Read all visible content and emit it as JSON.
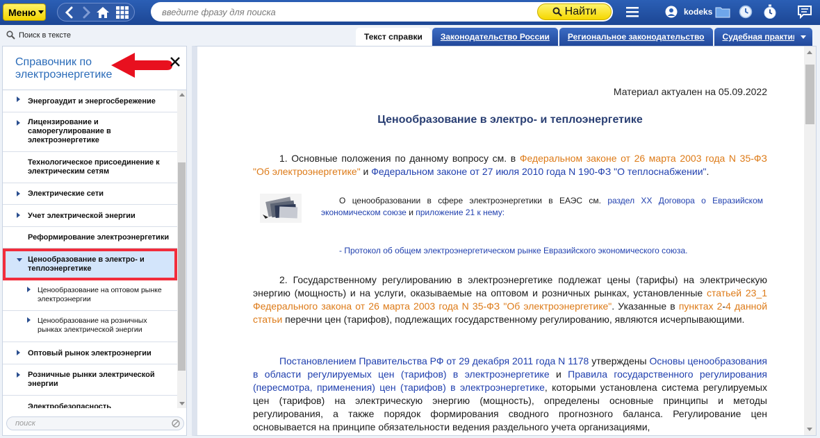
{
  "topbar": {
    "menu_label": "Меню",
    "search_placeholder": "введите фразу для поиска",
    "find_label": "Найти",
    "user_name": "kodeks"
  },
  "row2": {
    "search_in_text": "Поиск в тексте",
    "tabs": [
      {
        "label": "Текст справки",
        "active": true
      },
      {
        "label": "Законодательство России",
        "active": false
      },
      {
        "label": "Региональное законодательство",
        "active": false
      },
      {
        "label": "Судебная практика",
        "active": false
      }
    ]
  },
  "left_panel": {
    "title": "Справочник по электроэнергетике",
    "search_placeholder": "поиск",
    "items": [
      {
        "label": "Энергоаудит и энергосбережение",
        "level": 1
      },
      {
        "label": "Лицензирование и саморегулирование в электроэнергетике",
        "level": 1
      },
      {
        "label": "Технологическое присоединение к электрическим сетям",
        "level": 1
      },
      {
        "label": "Электрические сети",
        "level": 1
      },
      {
        "label": "Учет электрической энергии",
        "level": 1
      },
      {
        "label": "Реформирование электроэнергетики",
        "level": 1
      },
      {
        "label": "Ценообразование в электро- и теплоэнергетике",
        "level": 1,
        "selected": true
      },
      {
        "label": "Ценообразование на оптовом рынке электроэнергии",
        "level": 2
      },
      {
        "label": "Ценообразование на розничных рынках электрической энергии",
        "level": 2
      },
      {
        "label": "Оптовый рынок электроэнергии",
        "level": 1
      },
      {
        "label": "Розничные рынки электрической энергии",
        "level": 1
      },
      {
        "label": "Электробезопасность",
        "level": 1
      }
    ]
  },
  "document": {
    "actual": "Материал актуален на 05.09.2022",
    "title": "Ценообразование в электро- и теплоэнергетике",
    "p1": {
      "t1": "1. Основные положения по данному вопросу см. в ",
      "l1": "Федеральном законе от 26 марта 2003 года N 35-ФЗ \"Об электроэнергетике\"",
      "t2": " и ",
      "l2": "Федеральном законе от 27 июля 2010 года N 190-ФЗ \"О теплоснабжении\"",
      "t3": "."
    },
    "eaes": {
      "t1": "О ценообразовании в сфере электроэнергетики в ЕАЭС см. ",
      "l1": "раздел XX Договора о Евразийском экономическом союзе",
      "t2": " и ",
      "l2": "приложение 21 к нему",
      "t3": ":"
    },
    "protocol": "- Протокол об общем электроэнергетическом рынке Евразийского экономического союза.",
    "p2": {
      "t1": "2. Государственному регулированию в электроэнергетике подлежат цены (тарифы) на электрическую энергию (мощность) и на услуги, оказываемые на оптовом и розничных рынках, установленные ",
      "l1": "статьей 23_1 Федерального закона от 26 марта 2003 года N 35-ФЗ \"Об электроэнергетике\"",
      "t2": ". Указанные в ",
      "l2": "пунктах 2",
      "t3": "-",
      "l3": "4 данной статьи",
      "t4": " перечни цен (тарифов), подлежащих государственному регулированию, являются исчерпывающими."
    },
    "p3": {
      "l1": "Постановлением Правительства РФ от 29 декабря 2011 года N 1178",
      "t1": " утверждены ",
      "l2": "Основы ценообразования в области регулируемых цен (тарифов) в электроэнергетике",
      "t2": " и ",
      "l3": "Правила государственного регулирования (пересмотра, применения) цен (тарифов) в электроэнергетике",
      "t3": ", которыми установлена система регулируемых цен (тарифов) на электрическую энергию (мощность), определены основные принципы и методы регулирования, а также порядок формирования сводного прогнозного баланса. Регулирование цен основывается на принципе обязательности ведения раздельного учета организациями,"
    }
  },
  "colors": {
    "topbar": "#1f4c9e",
    "accent_yellow": "#f5d700",
    "link_orange": "#dd7a17",
    "link_blue": "#1f3fae",
    "selection_outline": "#f22d3c",
    "annotation_arrow": "#e8101f"
  }
}
